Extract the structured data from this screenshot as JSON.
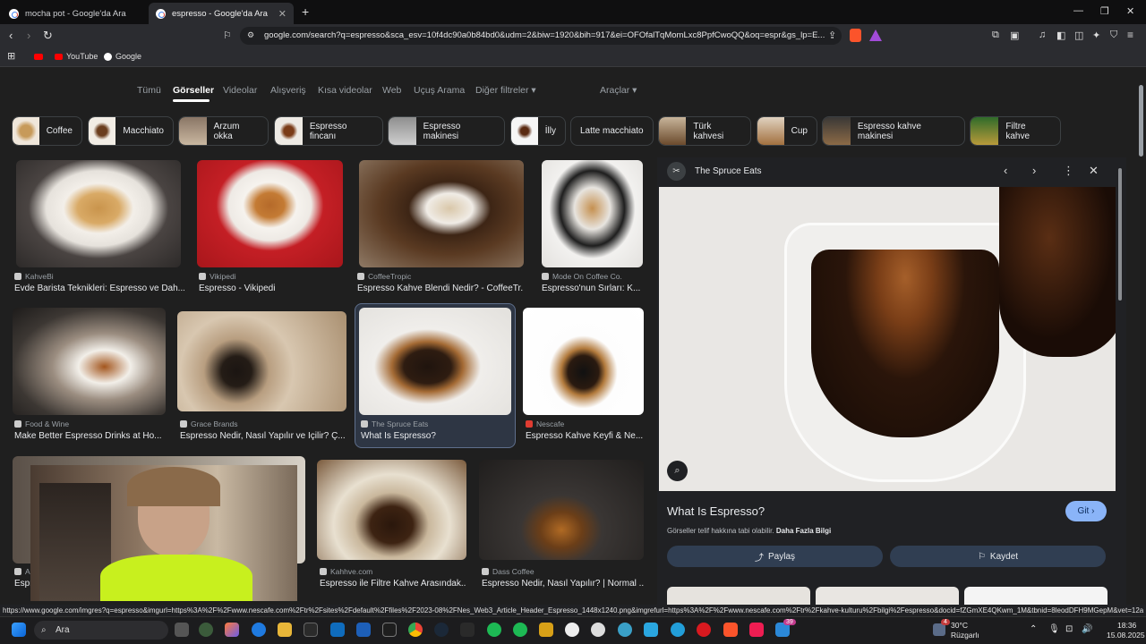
{
  "tabs": [
    {
      "title": "mocha pot - Google'da Ara",
      "active": false
    },
    {
      "title": "espresso - Google'da Ara",
      "active": true
    }
  ],
  "address": {
    "url": "google.com/search?q=espresso&sca_esv=10f4dc90a0b84bd0&udm=2&biw=1920&bih=917&ei=OFOfalTqMomLxc8PpfCwoQQ&oq=espr&gs_lp=E..."
  },
  "bookmarks": [
    {
      "label": "YouTube"
    },
    {
      "label": "Google"
    }
  ],
  "search_nav": {
    "items": [
      "Tümü",
      "Görseller",
      "Videolar",
      "Alışveriş",
      "Kısa videolar",
      "Web",
      "Uçuş Arama",
      "Diğer filtreler ▾"
    ],
    "tools": "Araçlar ▾"
  },
  "chips": [
    "Coffee",
    "Macchiato",
    "Arzum okka",
    "Espresso fincanı",
    "Espresso makinesi",
    "İlly",
    "Latte macchiato",
    "Türk kahvesi",
    "Cup",
    "Espresso kahve makinesi",
    "Filtre kahve"
  ],
  "results": [
    {
      "source": "KahveBi",
      "caption": "Evde Barista Teknikleri: Espresso ve Dah..."
    },
    {
      "source": "Vikipedi",
      "caption": "Espresso - Vikipedi"
    },
    {
      "source": "CoffeeTropic",
      "caption": "Espresso Kahve Blendi Nedir? - CoffeeTr..."
    },
    {
      "source": "Mode On Coffee Co.",
      "caption": "Espresso'nun Sırları: K..."
    },
    {
      "source": "Food & Wine",
      "caption": "Make Better Espresso Drinks at Ho..."
    },
    {
      "source": "Grace Brands",
      "caption": "Espresso Nedir, Nasıl Yapılır ve İçilir? Ç..."
    },
    {
      "source": "The Spruce Eats",
      "caption": "What Is Espresso?"
    },
    {
      "source": "Nescafe",
      "caption": "Espresso Kahve Keyfi & Ne..."
    },
    {
      "source": "Ar...",
      "caption": "Espr..."
    },
    {
      "source": "Kahhve.com",
      "caption": "Espresso ile Filtre Kahve Arasındak..."
    },
    {
      "source": "Dass Coffee",
      "caption": "Espresso Nedir, Nasıl Yapılır? | Normal ..."
    }
  ],
  "panel": {
    "source": "The Spruce Eats",
    "title": "What Is Espresso?",
    "go_label": "Git ›",
    "copyright_text": "Görseller telif hakkına tabi olabilir.",
    "more_info": "Daha Fazla Bilgi",
    "share_label": "Paylaş",
    "save_label": "Kaydet"
  },
  "status_url": "https://www.google.com/imgres?q=espresso&imgurl=https%3A%2F%2Fwww.nescafe.com%2Ftr%2Fsites%2Fdefault%2Ffiles%2F2023-08%2FNes_Web3_Article_Header_Espresso_1448x1240.png&imgrefurl=https%3A%2F%2Fwww.nescafe.com%2Ftr%2Fkahve-kulturu%2Fbilgi%2Fespresso&docid=fZGmXE4QKwm_1M&tbnid=8leodDFH9MGepM&vet=12a",
  "taskbar": {
    "search_label": "Ara",
    "weather_temp": "30°C",
    "weather_desc": "Rüzgarlı",
    "weather_badge": "4",
    "notification_count": "39",
    "time": "18:36",
    "date": "15.08.2025"
  }
}
